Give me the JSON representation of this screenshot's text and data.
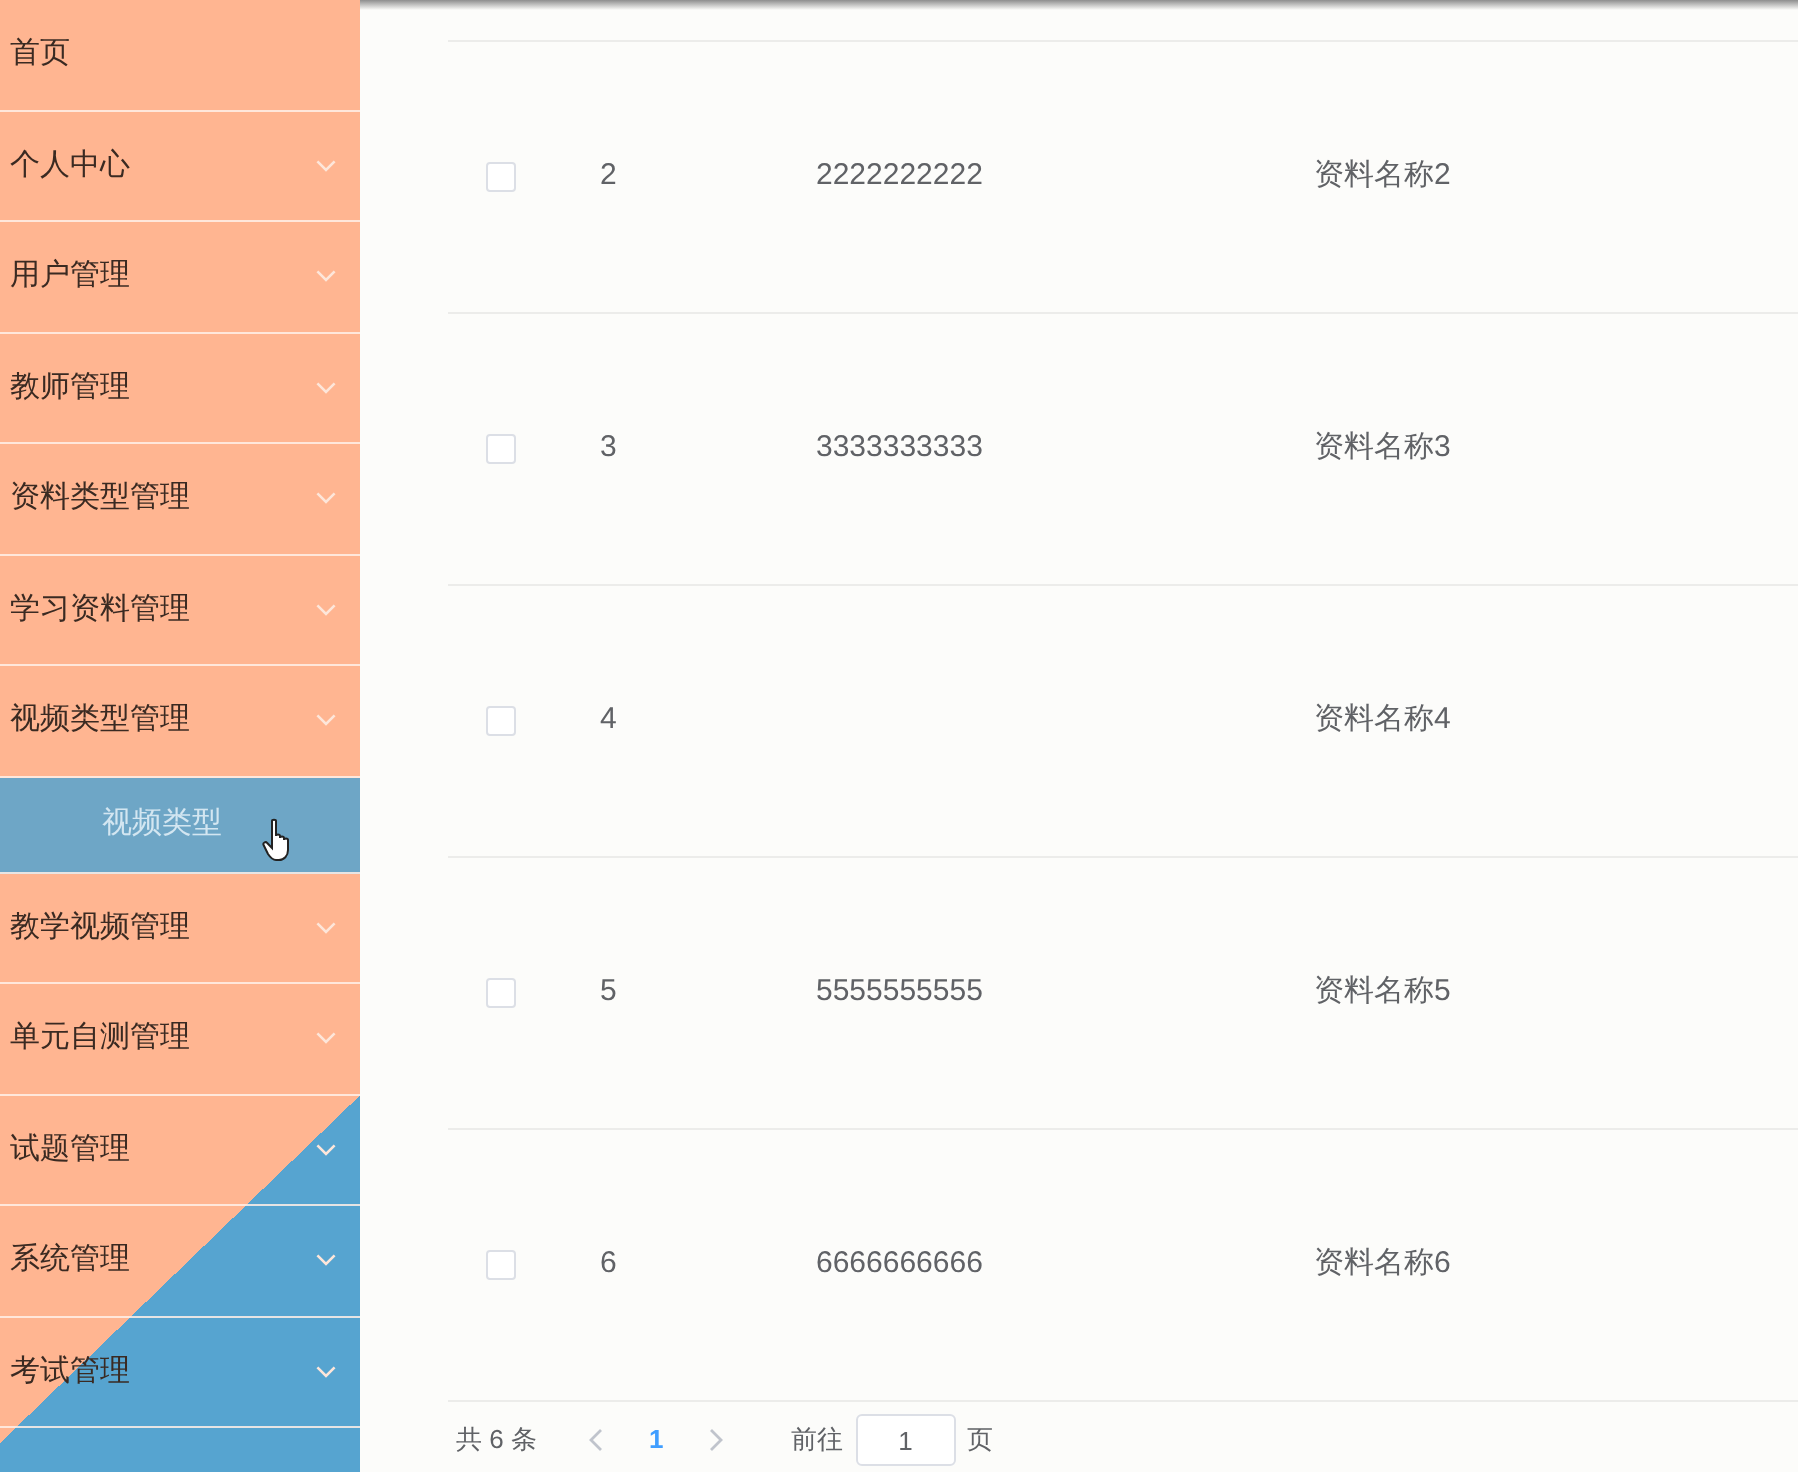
{
  "sidebar": {
    "items": [
      {
        "label": "首页",
        "kind": "link"
      },
      {
        "label": "个人中心",
        "kind": "submenu"
      },
      {
        "label": "用户管理",
        "kind": "submenu"
      },
      {
        "label": "教师管理",
        "kind": "submenu"
      },
      {
        "label": "资料类型管理",
        "kind": "submenu"
      },
      {
        "label": "学习资料管理",
        "kind": "submenu"
      },
      {
        "label": "视频类型管理",
        "kind": "submenu",
        "children": [
          {
            "label": "视频类型",
            "selected": true
          }
        ]
      },
      {
        "label": "教学视频管理",
        "kind": "submenu"
      },
      {
        "label": "单元自测管理",
        "kind": "submenu"
      },
      {
        "label": "试题管理",
        "kind": "submenu"
      },
      {
        "label": "系统管理",
        "kind": "submenu"
      },
      {
        "label": "考试管理",
        "kind": "submenu"
      }
    ]
  },
  "table": {
    "rows": [
      {
        "checked": false,
        "index": "2",
        "number": "2222222222",
        "name": "资料名称2"
      },
      {
        "checked": false,
        "index": "3",
        "number": "3333333333",
        "name": "资料名称3"
      },
      {
        "checked": false,
        "index": "4",
        "name": "资料名称4"
      },
      {
        "checked": false,
        "index": "5",
        "number": "5555555555",
        "name": "资料名称5"
      },
      {
        "checked": false,
        "index": "6",
        "number": "6666666666",
        "name": "资料名称6"
      }
    ]
  },
  "pagination": {
    "total": "共 6 条",
    "pages": [
      {
        "label": "1",
        "selected": true
      }
    ],
    "goto_label": "前往",
    "goto_value": "1",
    "goto_suffix": "页"
  }
}
